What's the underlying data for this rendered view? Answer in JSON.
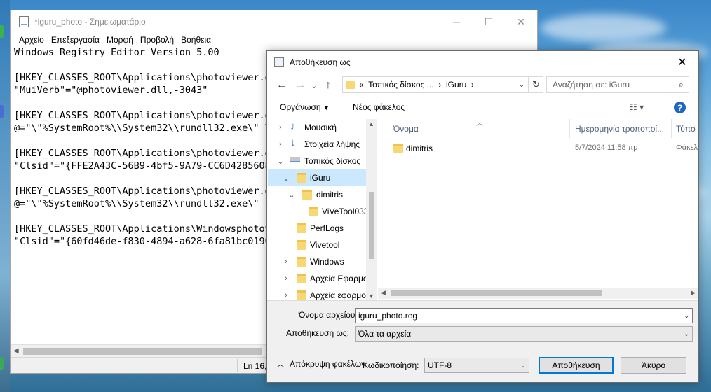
{
  "notepad": {
    "title": "*iguru_photo - Σημειωματάριο",
    "window_controls": {
      "minimize": "─",
      "maximize": "☐",
      "close": "✕"
    },
    "menu": [
      "Αρχείο",
      "Επεξεργασία",
      "Μορφή",
      "Προβολή",
      "Βοήθεια"
    ],
    "lines": [
      "Windows Registry Editor Version 5.00",
      "",
      "[HKEY_CLASSES_ROOT\\Applications\\photoviewer.dl",
      "\"MuiVerb\"=\"@photoviewer.dll,-3043\"",
      "",
      "[HKEY_CLASSES_ROOT\\Applications\\photoviewer.dl",
      "@=\"\\\"%SystemRoot%\\\\System32\\\\rundll32.exe\\\" \\",
      "",
      "[HKEY_CLASSES_ROOT\\Applications\\photoviewer.dl",
      "\"Clsid\"=\"{FFE2A43C-56B9-4bf5-9A79-CC6D4285608",
      "",
      "[HKEY_CLASSES_ROOT\\Applications\\photoviewer.dl",
      "@=\"\\\"%SystemRoot%\\\\System32\\\\rundll32.exe\\\" \\",
      "",
      "[HKEY_CLASSES_ROOT\\Applications\\Windowsphotov",
      "\"Clsid\"=\"{60fd46de-f830-4894-a628-6fa81bc0190"
    ],
    "status_position": "Ln 16,"
  },
  "dialog": {
    "title": "Αποθήκευση ως",
    "close": "✕",
    "nav": {
      "back": "←",
      "forward": "→",
      "up": "↑"
    },
    "address": {
      "prefix": "«",
      "segments": [
        "Τοπικός δίσκος ...",
        "iGuru"
      ],
      "separator": "›"
    },
    "search_placeholder": "Αναζήτηση σε: iGuru",
    "toolbar": {
      "organize": "Οργάνωση",
      "new_folder": "Νέος φάκελος",
      "view": "☷ ▾",
      "help": "?"
    },
    "tree": [
      {
        "label": "Μουσική",
        "chev": "›"
      },
      {
        "label": "Στοιχεία λήψης",
        "chev": "›"
      },
      {
        "label": "Τοπικός δίσκος",
        "chev": "⌄"
      },
      {
        "label": "iGuru",
        "chev": "⌄"
      },
      {
        "label": "dimitris",
        "chev": "⌄"
      },
      {
        "label": "ViVeTool033",
        "chev": ""
      },
      {
        "label": "PerfLogs",
        "chev": ""
      },
      {
        "label": "Vivetool",
        "chev": ""
      },
      {
        "label": "Windows",
        "chev": "›"
      },
      {
        "label": "Αρχεία Εφαρμο",
        "chev": "›"
      },
      {
        "label": "Αρχεία εφαρμο",
        "chev": "›"
      }
    ],
    "columns": [
      "Όνομα",
      "Ημερομηνία τροποποί...",
      "Τύπο"
    ],
    "files": [
      {
        "name": "dimitris",
        "date": "5/7/2024 11:58 πμ",
        "type": "Φάκελ"
      }
    ],
    "filename_label": "Όνομα αρχείου:",
    "filename_value": "iguru_photo.reg",
    "savetype_label": "Αποθήκευση ως:",
    "savetype_value": "Όλα τα αρχεία",
    "hide_folders": "Απόκρυψη φακέλων",
    "encoding_label": "Κωδικοποίηση:",
    "encoding_value": "UTF-8",
    "save_button": "Αποθήκευση",
    "cancel_button": "Άκυρο"
  },
  "colors": {
    "accent": "#0078d7",
    "selection": "#cce8ff",
    "folder": "#f8d775",
    "help": "#1e66c4"
  }
}
